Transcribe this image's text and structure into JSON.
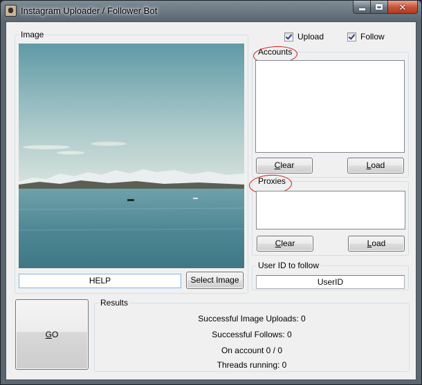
{
  "window": {
    "title": "Instagram Uploader / Follower Bot"
  },
  "options": {
    "upload_label": "Upload",
    "upload_checked": true,
    "follow_label": "Follow",
    "follow_checked": true
  },
  "image_group": {
    "legend": "Image",
    "path_value": "HELP",
    "select_button": "Select Image"
  },
  "accounts": {
    "legend": "Accounts",
    "clear_button": "Clear",
    "load_button": "Load"
  },
  "proxies": {
    "legend": "Proxies",
    "clear_button": "Clear",
    "load_button": "Load"
  },
  "follow_target": {
    "legend": "User ID to follow",
    "value": "UserID"
  },
  "go_button": "GO",
  "results": {
    "legend": "Results",
    "uploads": "Successful Image Uploads: 0",
    "follows": "Successful Follows: 0",
    "on_account": "On account 0 / 0",
    "threads": "Threads running: 0"
  },
  "icons": {
    "app": "camera-app-icon",
    "minimize": "minimize-icon",
    "maximize": "maximize-icon",
    "close": "close-icon",
    "checkbox": "checkmark-icon"
  },
  "colors": {
    "annotation": "#d01818",
    "close_button": "#c8553b",
    "sky": "#a9c8cc",
    "sea": "#5a8f9a"
  }
}
